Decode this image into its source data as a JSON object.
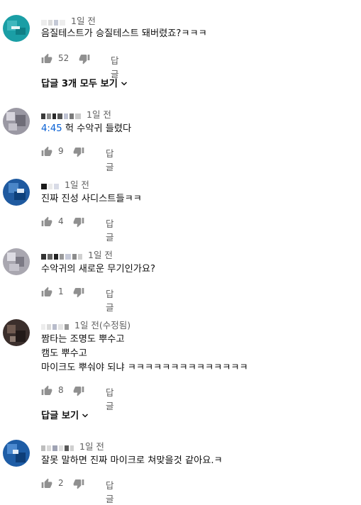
{
  "comments": [
    {
      "time": "1일 전",
      "text_parts": [
        {
          "t": "음질테스트가 승질테스트 돼버렸죠?ㅋㅋㅋ",
          "ts": false
        }
      ],
      "likes": "52",
      "reply_label": "답글",
      "replies_toggle": "답글 3개 모두 보기",
      "avatar_colors": [
        "#1a9ea5",
        "#3fb7bd",
        "#0e7f86"
      ]
    },
    {
      "time": "1일 전",
      "text_parts": [
        {
          "t": "4:45",
          "ts": true
        },
        {
          "t": " 헉 수악귀 들렸다",
          "ts": false
        }
      ],
      "likes": "9",
      "reply_label": "답글",
      "avatar_colors": [
        "#9a98a3",
        "#d6d4dc",
        "#6f6d78"
      ]
    },
    {
      "time": "1일 전",
      "text_parts": [
        {
          "t": "진짜 진성 사디스트들ㅋㅋ",
          "ts": false
        }
      ],
      "likes": "4",
      "reply_label": "답글",
      "avatar_colors": [
        "#1f5aa0",
        "#4a86c8",
        "#0c3f7a"
      ]
    },
    {
      "time": "1일 전",
      "text_parts": [
        {
          "t": "수악귀의 새로운 무기인가요?",
          "ts": false
        }
      ],
      "likes": "1",
      "reply_label": "답글",
      "avatar_colors": [
        "#a9a7b0",
        "#dddce3",
        "#7c7a85"
      ]
    },
    {
      "time": "1일 전(수정됨)",
      "text_lines": [
        "짬타는 조명도 뿌수고",
        "캠도 뿌수고",
        "마이크도 뿌숴야 되냐 ㅋㅋㅋㅋㅋㅋㅋㅋㅋㅋㅋㅋㅋㅋ"
      ],
      "likes": "8",
      "reply_label": "답글",
      "replies_toggle": "답글 보기",
      "avatar_colors": [
        "#3b2f2c",
        "#6f5a50",
        "#221a18"
      ]
    },
    {
      "time": "1일 전",
      "text_parts": [
        {
          "t": "잘못 말하면 진짜 마이크로 쳐맞을것 같아요.ㅋ",
          "ts": false
        }
      ],
      "likes": "2",
      "reply_label": "답글",
      "avatar_colors": [
        "#1e5da6",
        "#4c8ad0",
        "#0d3e78"
      ]
    }
  ],
  "colors": {
    "link": "#065fd4",
    "secondary": "#606060",
    "primary": "#0f0f0f"
  },
  "icons": {
    "like": "thumb-up-icon",
    "dislike": "thumb-down-icon",
    "expand": "chevron-down-icon"
  }
}
